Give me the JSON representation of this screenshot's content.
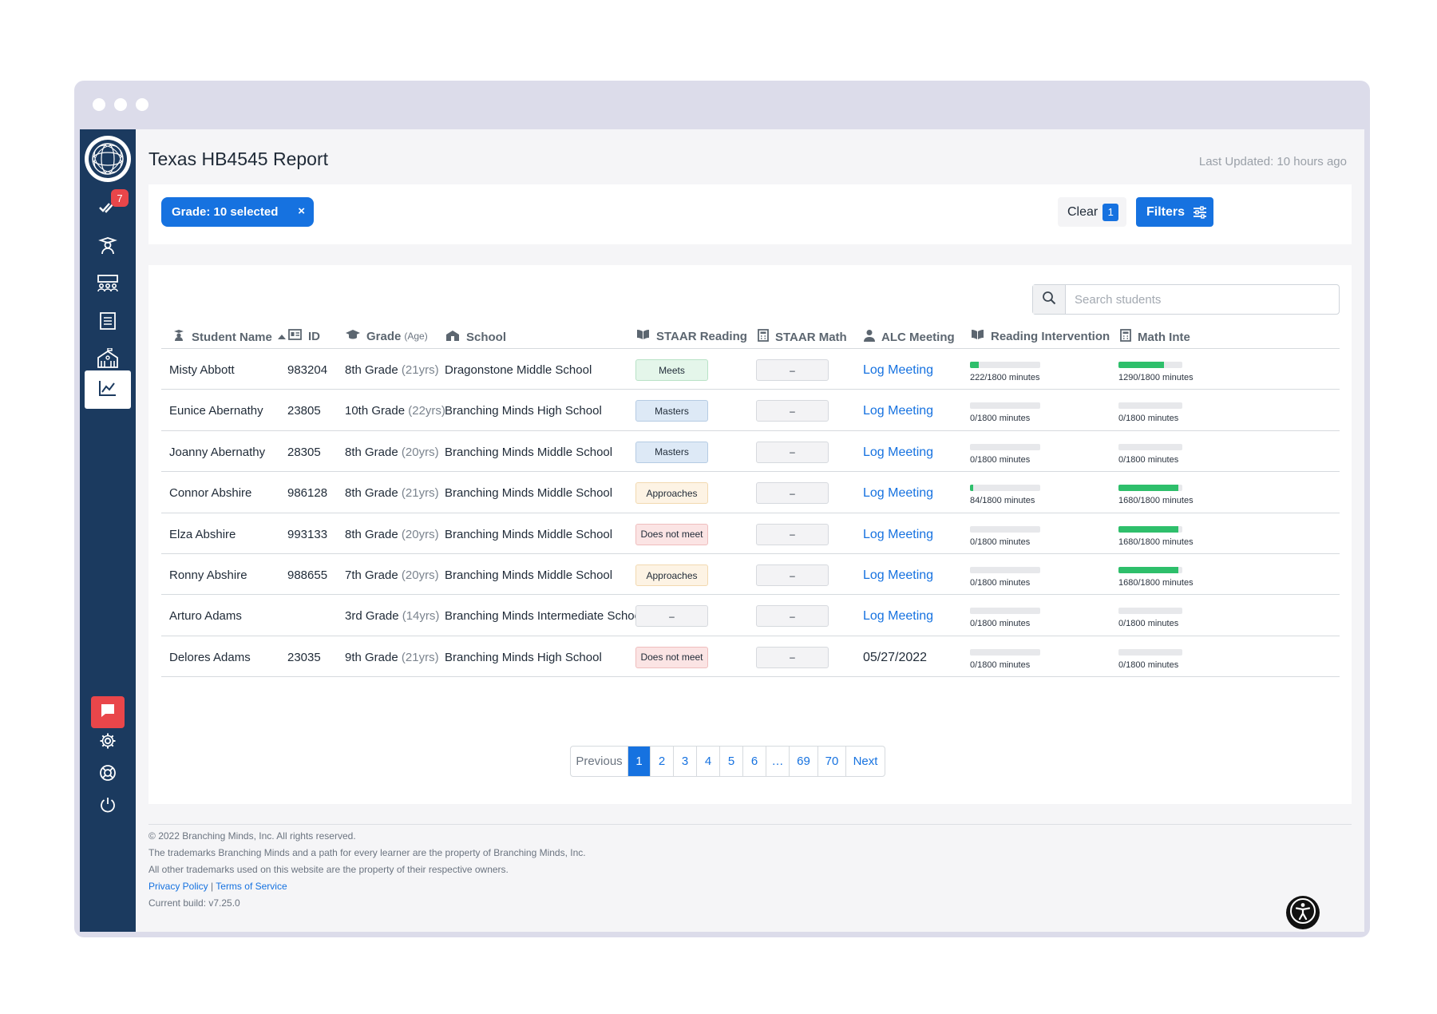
{
  "window": {
    "dots": [
      "close",
      "minimize",
      "maximize"
    ]
  },
  "sidebar": {
    "logo_icon": "globe-logo-icon",
    "tasks_badge": "7",
    "items": [
      {
        "name": "tasks",
        "icon": "double-check-icon"
      },
      {
        "name": "students",
        "icon": "student-icon"
      },
      {
        "name": "groups",
        "icon": "group-icon"
      },
      {
        "name": "interventions",
        "icon": "notebook-icon"
      },
      {
        "name": "schools",
        "icon": "school-building-icon"
      },
      {
        "name": "reports",
        "icon": "chart-icon",
        "active": true
      }
    ],
    "bottom_items": [
      {
        "name": "chat",
        "icon": "chat-icon"
      },
      {
        "name": "settings",
        "icon": "gear-icon"
      },
      {
        "name": "help",
        "icon": "lifebuoy-icon"
      },
      {
        "name": "logout",
        "icon": "power-icon"
      }
    ]
  },
  "header": {
    "title": "Texas HB4545 Report",
    "last_updated": "Last Updated: 10 hours ago"
  },
  "filters": {
    "chip_label": "Grade: 10 selected",
    "chip_remove": "×",
    "clear_label": "Clear",
    "clear_count": "1",
    "filters_label": "Filters"
  },
  "search": {
    "placeholder": "Search students"
  },
  "table": {
    "columns": [
      {
        "key": "name",
        "label": "Student Name",
        "icon": "student-icon"
      },
      {
        "key": "id",
        "label": "ID",
        "icon": "id-card-icon"
      },
      {
        "key": "grade",
        "label": "Grade",
        "sub": "(Age)",
        "icon": "graduation-cap-icon"
      },
      {
        "key": "school",
        "label": "School",
        "icon": "school-building-icon"
      },
      {
        "key": "reading",
        "label": "STAAR Reading",
        "icon": "book-icon"
      },
      {
        "key": "math",
        "label": "STAAR Math",
        "icon": "calculator-icon"
      },
      {
        "key": "alc",
        "label": "ALC Meeting",
        "icon": "person-icon"
      },
      {
        "key": "read_int",
        "label": "Reading Intervention",
        "icon": "book-icon"
      },
      {
        "key": "math_int",
        "label": "Math Inte",
        "icon": "calculator-icon"
      }
    ],
    "rows": [
      {
        "name": "Misty Abbott",
        "id": "983204",
        "grade": "8th Grade",
        "age": "(21yrs)",
        "school": "Dragonstone Middle School",
        "reading": "Meets",
        "reading_style": "meets",
        "math": "–",
        "alc": "Log Meeting",
        "alc_link": true,
        "read_int": "222/1800 minutes",
        "read_frac": 0.123,
        "math_int": "1290/1800 minutes",
        "math_frac": 0.717
      },
      {
        "name": "Eunice Abernathy",
        "id": "23805",
        "grade": "10th Grade",
        "age": "(22yrs)",
        "school": "Branching Minds High School",
        "reading": "Masters",
        "reading_style": "masters",
        "math": "–",
        "alc": "Log Meeting",
        "alc_link": true,
        "read_int": "0/1800 minutes",
        "read_frac": 0,
        "math_int": "0/1800 minutes",
        "math_frac": 0
      },
      {
        "name": "Joanny Abernathy",
        "id": "28305",
        "grade": "8th Grade",
        "age": "(20yrs)",
        "school": "Branching Minds Middle School",
        "reading": "Masters",
        "reading_style": "masters",
        "math": "–",
        "alc": "Log Meeting",
        "alc_link": true,
        "read_int": "0/1800 minutes",
        "read_frac": 0,
        "math_int": "0/1800 minutes",
        "math_frac": 0
      },
      {
        "name": "Connor Abshire",
        "id": "986128",
        "grade": "8th Grade",
        "age": "(21yrs)",
        "school": "Branching Minds Middle School",
        "reading": "Approaches",
        "reading_style": "approaches",
        "math": "–",
        "alc": "Log Meeting",
        "alc_link": true,
        "read_int": "84/1800 minutes",
        "read_frac": 0.047,
        "math_int": "1680/1800 minutes",
        "math_frac": 0.933
      },
      {
        "name": "Elza Abshire",
        "id": "993133",
        "grade": "8th Grade",
        "age": "(20yrs)",
        "school": "Branching Minds Middle School",
        "reading": "Does not meet",
        "reading_style": "notmeet",
        "math": "–",
        "alc": "Log Meeting",
        "alc_link": true,
        "read_int": "0/1800 minutes",
        "read_frac": 0,
        "math_int": "1680/1800 minutes",
        "math_frac": 0.933
      },
      {
        "name": "Ronny Abshire",
        "id": "988655",
        "grade": "7th Grade",
        "age": "(20yrs)",
        "school": "Branching Minds Middle School",
        "reading": "Approaches",
        "reading_style": "approaches",
        "math": "–",
        "alc": "Log Meeting",
        "alc_link": true,
        "read_int": "0/1800 minutes",
        "read_frac": 0,
        "math_int": "1680/1800 minutes",
        "math_frac": 0.933
      },
      {
        "name": "Arturo Adams",
        "id": "",
        "grade": "3rd Grade",
        "age": "(14yrs)",
        "school": "Branching Minds Intermediate School",
        "reading": "–",
        "reading_style": "none",
        "math": "–",
        "alc": "Log Meeting",
        "alc_link": true,
        "read_int": "0/1800 minutes",
        "read_frac": 0,
        "math_int": "0/1800 minutes",
        "math_frac": 0
      },
      {
        "name": "Delores Adams",
        "id": "23035",
        "grade": "9th Grade",
        "age": "(21yrs)",
        "school": "Branching Minds High School",
        "reading": "Does not meet",
        "reading_style": "notmeet",
        "math": "–",
        "alc": "05/27/2022",
        "alc_link": false,
        "read_int": "0/1800 minutes",
        "read_frac": 0,
        "math_int": "0/1800 minutes",
        "math_frac": 0
      }
    ]
  },
  "pagination": {
    "previous": "Previous",
    "pages": [
      "1",
      "2",
      "3",
      "4",
      "5",
      "6",
      "…",
      "69",
      "70"
    ],
    "current": "1",
    "next": "Next"
  },
  "footer": {
    "copyright": "2022 Branching Minds, Inc. All rights reserved.",
    "trademark1": "The trademarks Branching Minds and a path for every learner are the property of Branching Minds, Inc.",
    "trademark2": "All other trademarks used on this website are the property of their respective owners.",
    "privacy": "Privacy Policy",
    "separator": " | ",
    "terms": "Terms of Service",
    "build": "Current build: v7.25.0"
  },
  "colors": {
    "sidebar": "#1b3a5f",
    "accent": "#1672e0",
    "badge": "#e9464a",
    "progress": "#2ebf6b"
  }
}
